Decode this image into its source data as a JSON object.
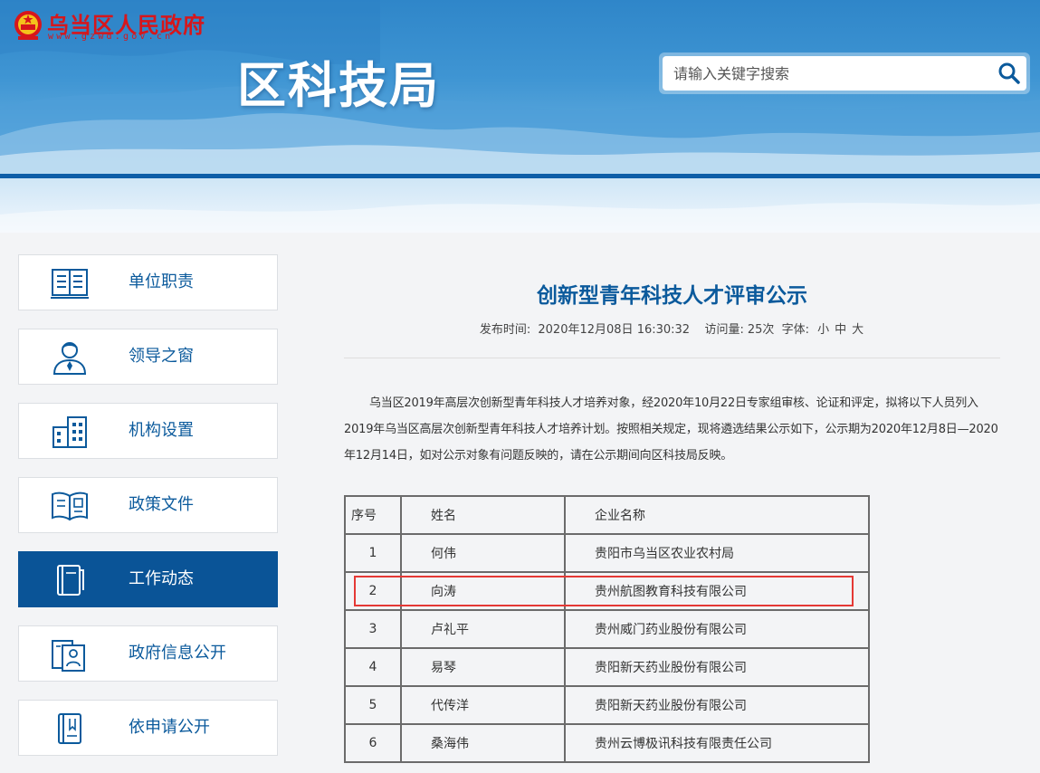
{
  "header": {
    "gov_name": "乌当区人民政府",
    "gov_url": "www.gzwd.gov.cn",
    "dept_title": "区科技局",
    "search": {
      "placeholder": "请输入关键字搜索"
    }
  },
  "sidebar": {
    "items": [
      {
        "label": "单位职责",
        "icon": "document-list-icon",
        "active": false
      },
      {
        "label": "领导之窗",
        "icon": "leader-icon",
        "active": false
      },
      {
        "label": "机构设置",
        "icon": "building-icon",
        "active": false
      },
      {
        "label": "政策文件",
        "icon": "open-book-icon",
        "active": false
      },
      {
        "label": "工作动态",
        "icon": "notebook-icon",
        "active": true
      },
      {
        "label": "政府信息公开",
        "icon": "info-file-icon",
        "active": false
      },
      {
        "label": "依申请公开",
        "icon": "application-book-icon",
        "active": false
      }
    ]
  },
  "article": {
    "title": "创新型青年科技人才评审公示",
    "meta": {
      "publish_label": "发布时间:",
      "publish_time": "2020年12月08日 16:30:32",
      "views_label": "访问量:",
      "views": "25次",
      "font_label": "字体:",
      "font_small": "小",
      "font_medium": "中",
      "font_large": "大"
    },
    "paragraph": "乌当区2019年高层次创新型青年科技人才培养对象，经2020年10月22日专家组审核、论证和评定，拟将以下人员列入2019年乌当区高层次创新型青年科技人才培养计划。按照相关规定，现将遴选结果公示如下，公示期为2020年12月8日—2020年12月14日，如对公示对象有问题反映的，请在公示期间向区科技局反映。",
    "table": {
      "headers": [
        "序号",
        "姓名",
        "企业名称"
      ],
      "rows": [
        [
          "1",
          "何伟",
          "贵阳市乌当区农业农村局"
        ],
        [
          "2",
          "向涛",
          "贵州航图教育科技有限公司"
        ],
        [
          "3",
          "卢礼平",
          "贵州威门药业股份有限公司"
        ],
        [
          "4",
          "易琴",
          "贵阳新天药业股份有限公司"
        ],
        [
          "5",
          "代传洋",
          "贵阳新天药业股份有限公司"
        ],
        [
          "6",
          "桑海伟",
          "贵州云博极讯科技有限责任公司"
        ]
      ],
      "highlighted_row": "2"
    }
  },
  "colors": {
    "primary_blue": "#0b5a9c",
    "active_bg": "#0a5497",
    "gov_red": "#d7161b",
    "highlight_red": "#e53935"
  }
}
